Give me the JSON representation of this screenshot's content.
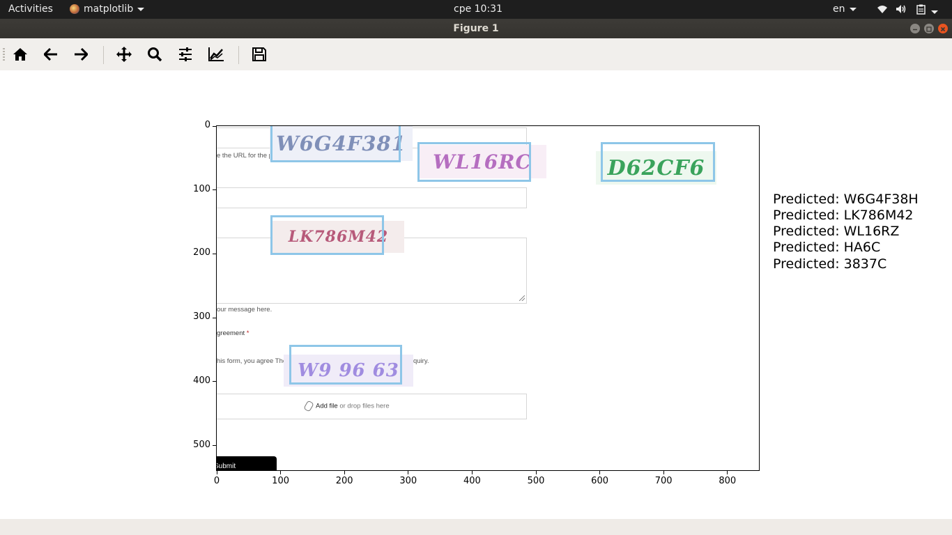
{
  "topbar": {
    "activities": "Activities",
    "app_name": "matplotlib",
    "clock": "cpe 10:31",
    "language": "en"
  },
  "window": {
    "title": "Figure 1"
  },
  "axes": {
    "x_ticks": [
      "0",
      "100",
      "200",
      "300",
      "400",
      "500",
      "600",
      "700",
      "800"
    ],
    "y_ticks": [
      "0",
      "100",
      "200",
      "300",
      "400",
      "500"
    ]
  },
  "form": {
    "url_hint": "e the URL for the page",
    "message_hint": "our message here.",
    "agreement_label": "greement",
    "required_mark": "*",
    "agree_text_left": "his form, you agree The",
    "agree_text_right": "quiry.",
    "add_file": "Add file",
    "drop_files": " or drop files here",
    "submit": "Submit"
  },
  "captchas": [
    {
      "text": "W6G4F381",
      "color": "#7f8fb8",
      "bg": "#eef0f8"
    },
    {
      "text": "WL16RC",
      "color": "#b56ec0",
      "bg": "#f8eef6"
    },
    {
      "text": "D62CF6",
      "color": "#3aa35c",
      "bg": "#eef8ef"
    },
    {
      "text": "LK786M42",
      "color": "#b75a7a",
      "bg": "#f4ecec"
    },
    {
      "text": "W9 96 63",
      "color": "#a08ce0",
      "bg": "#f0ecf8"
    }
  ],
  "predictions": [
    "Predicted: W6G4F38H",
    "Predicted: LK786M42",
    "Predicted: WL16RZ",
    "Predicted: HA6C",
    "Predicted: 3837C"
  ]
}
